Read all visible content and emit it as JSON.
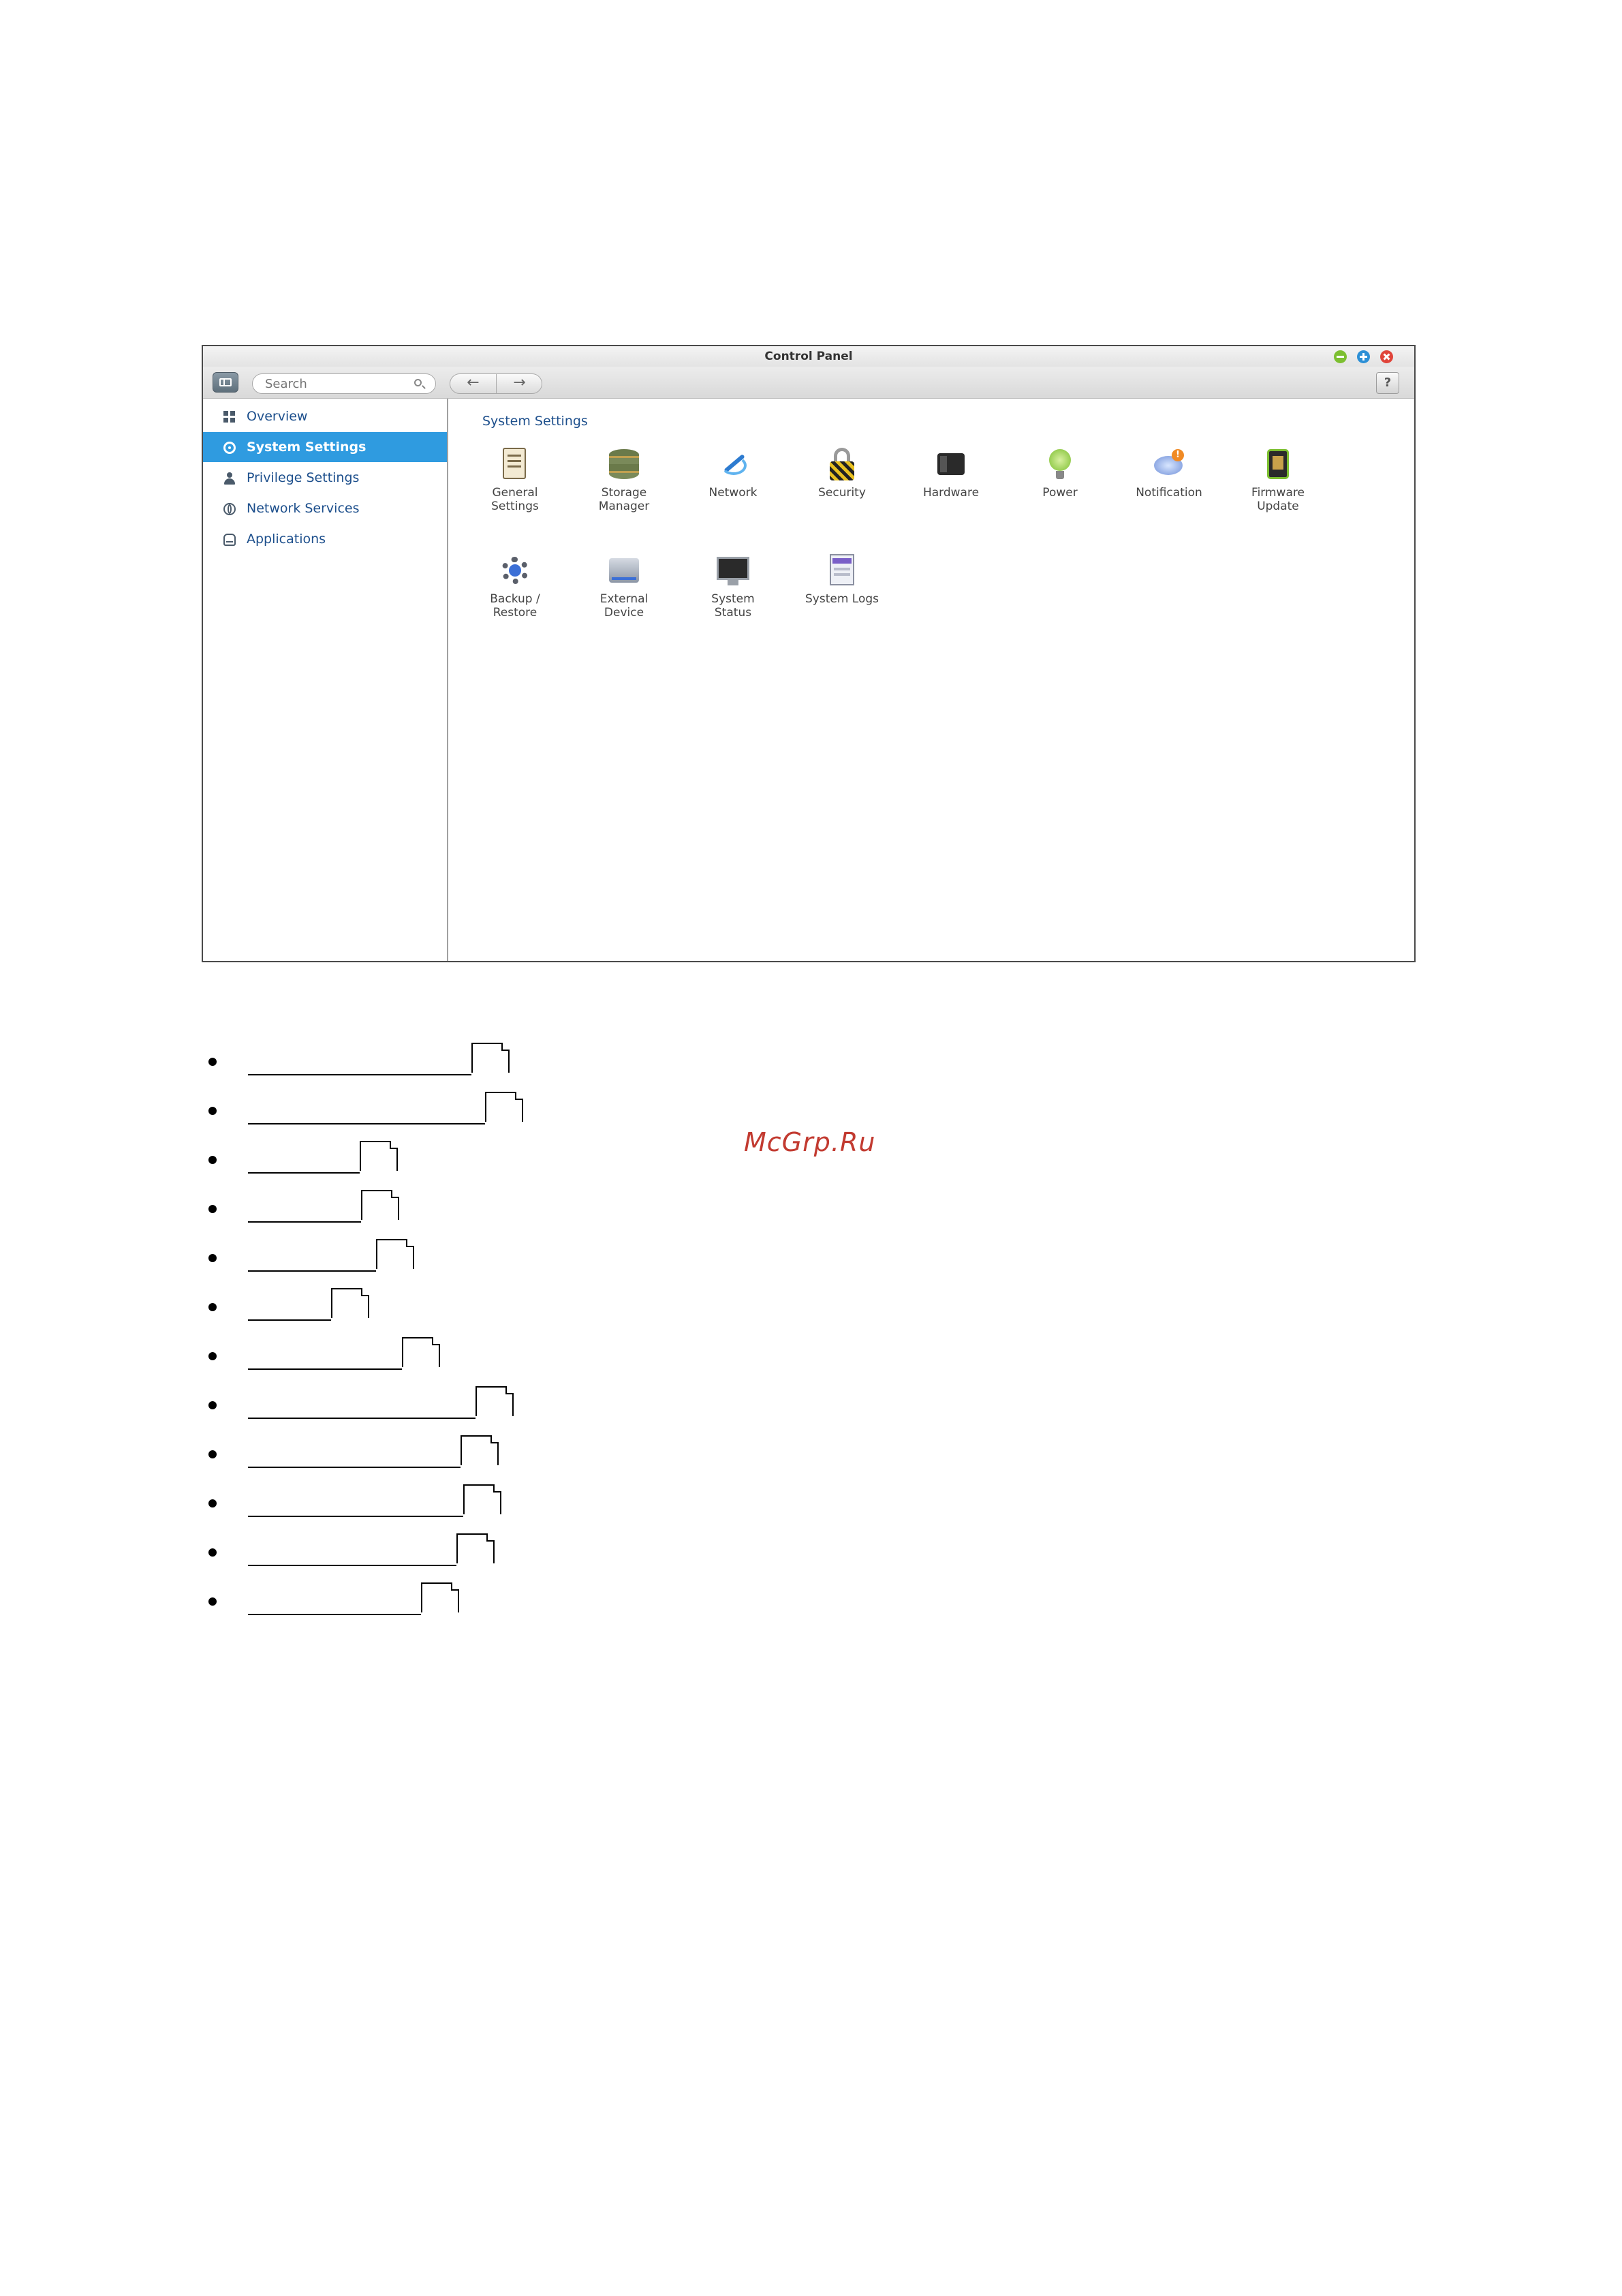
{
  "window": {
    "title": "Control Panel",
    "search_placeholder": "Search",
    "back_glyph": "←",
    "forward_glyph": "→",
    "help_label": "?"
  },
  "sidebar": {
    "items": [
      {
        "label": "Overview",
        "icon": "overview-icon",
        "active": false
      },
      {
        "label": "System Settings",
        "icon": "gear-icon",
        "active": true
      },
      {
        "label": "Privilege Settings",
        "icon": "user-icon",
        "active": false
      },
      {
        "label": "Network Services",
        "icon": "globe-icon",
        "active": false
      },
      {
        "label": "Applications",
        "icon": "applications-icon",
        "active": false
      }
    ]
  },
  "main": {
    "title": "System Settings",
    "tiles": [
      {
        "label": "General\nSettings",
        "icon": "general-settings-icon"
      },
      {
        "label": "Storage\nManager",
        "icon": "storage-manager-icon"
      },
      {
        "label": "Network",
        "icon": "network-icon"
      },
      {
        "label": "Security",
        "icon": "padlock-icon"
      },
      {
        "label": "Hardware",
        "icon": "hardware-icon"
      },
      {
        "label": "Power",
        "icon": "power-bulb-icon"
      },
      {
        "label": "Notification",
        "icon": "notification-icon"
      },
      {
        "label": "Firmware\nUpdate",
        "icon": "firmware-update-icon"
      },
      {
        "label": "Backup /\nRestore",
        "icon": "backup-restore-icon"
      },
      {
        "label": "External\nDevice",
        "icon": "external-device-icon"
      },
      {
        "label": "System\nStatus",
        "icon": "system-status-icon"
      },
      {
        "label": "System Logs",
        "icon": "system-logs-icon"
      }
    ]
  },
  "link_list": {
    "count": 12,
    "page_ref_icon": "page-reference-icon"
  },
  "watermark": "McGrp.Ru",
  "colors": {
    "active_sidebar": "#2f9be0",
    "link_text": "#1d4f8c",
    "watermark": "#c23a30"
  }
}
